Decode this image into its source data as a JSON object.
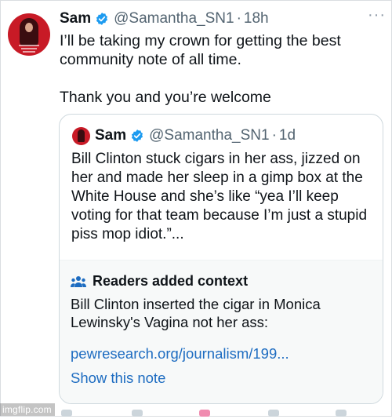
{
  "tweet": {
    "author": "Sam",
    "handle": "@Samantha_SN1",
    "separator": "·",
    "time": "18h",
    "more": "···",
    "text_line1": "I’ll be taking my crown for getting the best community note of all time.",
    "text_line2": "Thank you and you’re welcome"
  },
  "quote": {
    "author": "Sam",
    "handle": "@Samantha_SN1",
    "separator": "·",
    "time": "1d",
    "text": "Bill Clinton stuck cigars in her ass, jizzed on her and made her sleep in a gimp box at the White House and she’s like “yea I’ll keep voting for that team because I’m just a stupid piss mop idiot.”...",
    "context": {
      "title": "Readers added context",
      "body": "Bill Clinton inserted the cigar in Monica Lewinsky's Vagina not her ass:",
      "link": "pewresearch.org/journalism/199...",
      "show_note": "Show this note"
    }
  },
  "watermark": "imgflip.com",
  "colors": {
    "verified_badge": "#1d9bf0",
    "link": "#1d6cc1",
    "muted_text": "#536471",
    "avatar_background": "#c81a26"
  },
  "icons": [
    "verified-badge-icon",
    "more-icon",
    "people-icon",
    "reply-icon",
    "retweet-icon",
    "like-icon",
    "views-icon",
    "bookmark-icon"
  ]
}
